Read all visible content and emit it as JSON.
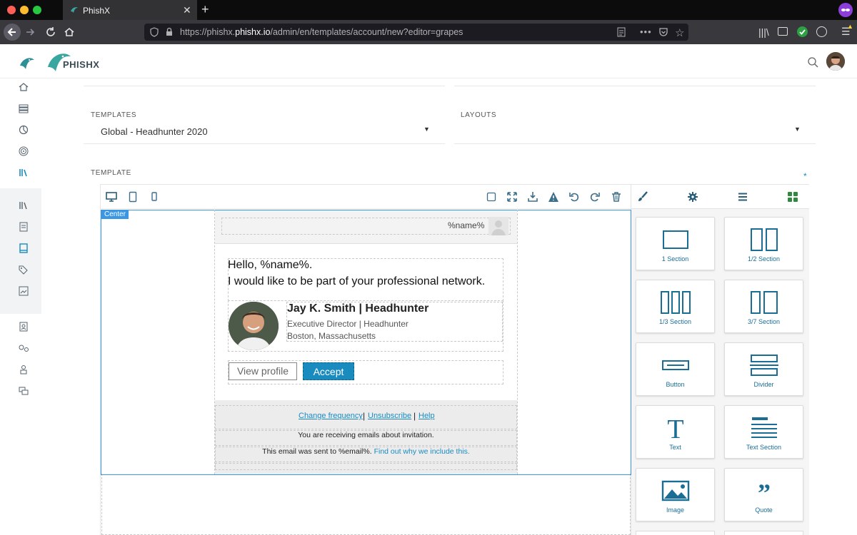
{
  "browser": {
    "tab_title": "PhishX",
    "url_prefix": "https://phishx.",
    "url_domain": "phishx.io",
    "url_path": "/admin/en/templates/account/new?editor=grapes"
  },
  "app": {
    "logo_text": "PHISHX"
  },
  "form": {
    "templates_label": "TEMPLATES",
    "templates_value": "Global - Headhunter 2020",
    "layouts_label": "LAYOUTS",
    "layouts_value": "",
    "template_label": "TEMPLATE",
    "required_mark": "*"
  },
  "editor": {
    "selected_badge": "Center",
    "email": {
      "header_name": "%name%",
      "greeting": "Hello, %name%.",
      "message": "I would like to be part of your professional network.",
      "contact_name": "Jay K. Smith | Headhunter",
      "contact_title": "Executive Director | Headhunter",
      "contact_location": "Boston, Massachusetts",
      "view_profile": "View profile",
      "accept": "Accept",
      "footer_link_frequency": "Change frequency",
      "footer_link_unsubscribe": "Unsubscribe",
      "footer_link_help": "Help",
      "footer_sep": "|",
      "footer_notice": "You are receiving emails about invitation.",
      "footer_sent_prefix": "This email was sent to %email%.",
      "footer_sent_link": "Find out why we include this."
    },
    "blocks": [
      {
        "label": "1 Section"
      },
      {
        "label": "1/2 Section"
      },
      {
        "label": "1/3 Section"
      },
      {
        "label": "3/7 Section"
      },
      {
        "label": "Button"
      },
      {
        "label": "Divider"
      },
      {
        "label": "Text"
      },
      {
        "label": "Text Section"
      },
      {
        "label": "Image"
      },
      {
        "label": "Quote"
      }
    ]
  },
  "colors": {
    "accent": "#1a8bbf",
    "icon": "#1a6e96",
    "sidebar_active": "#1a8bbf"
  }
}
